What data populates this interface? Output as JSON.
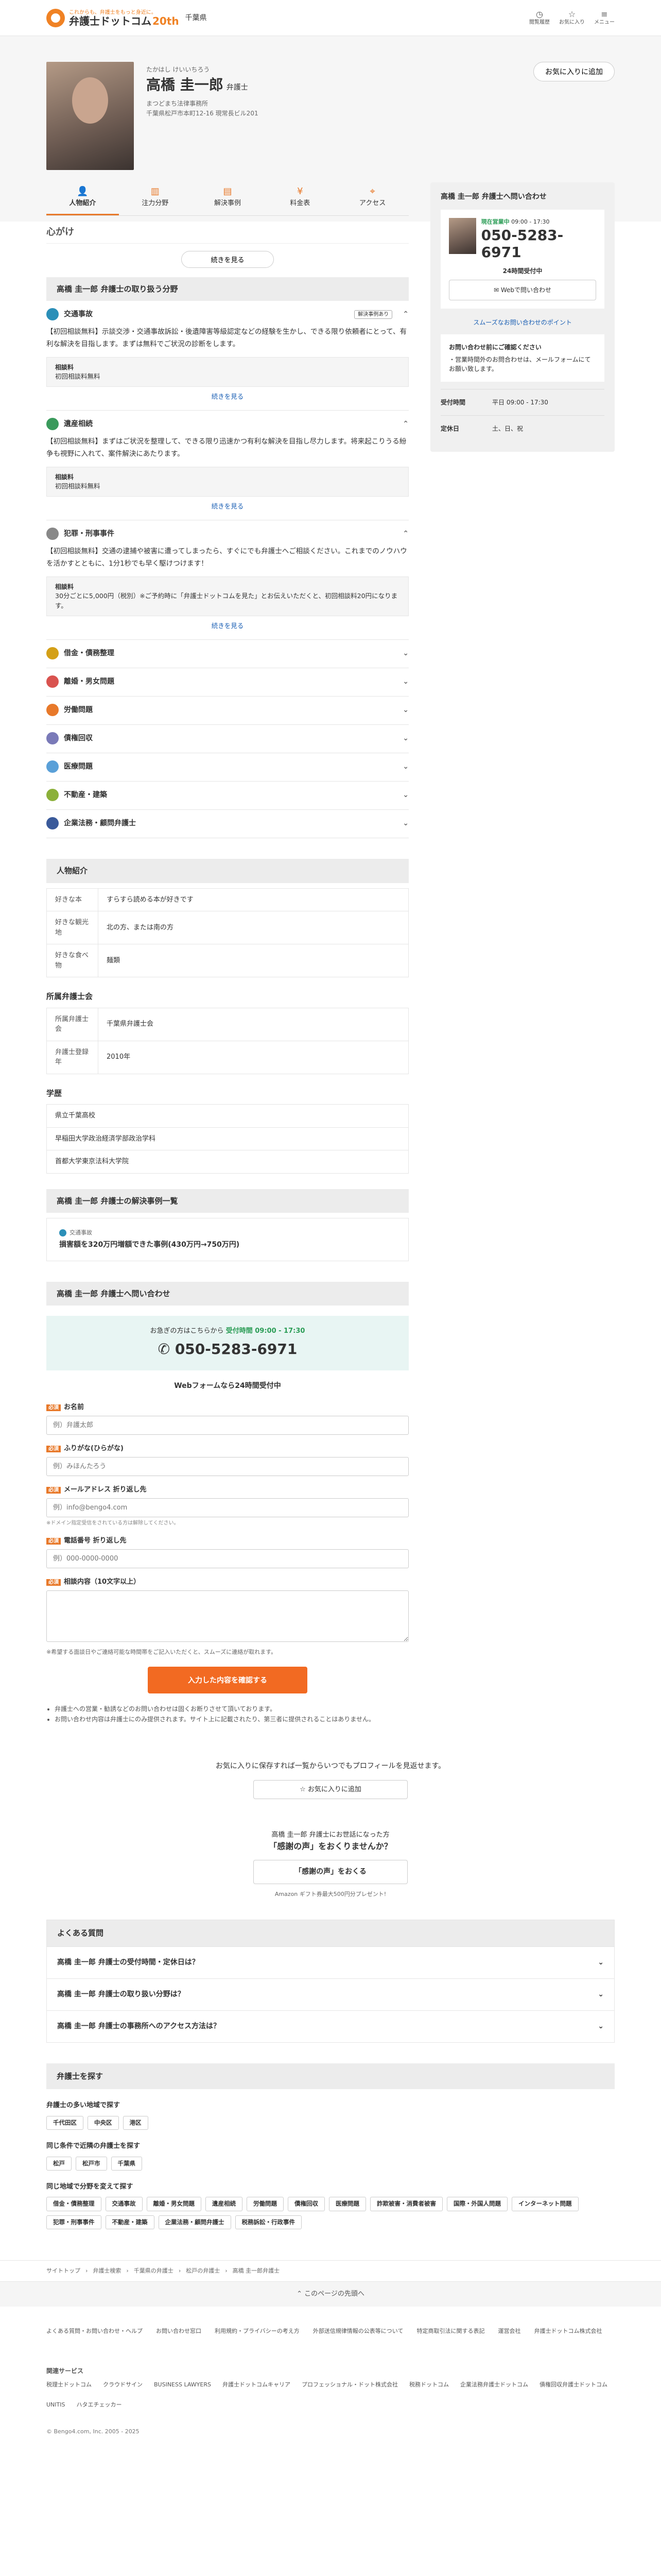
{
  "header": {
    "tagline": "これからも、弁護士をもっと身近に。",
    "brand": "弁護士ドットコム",
    "anniv": "20th",
    "pref": "千葉県",
    "icons": [
      {
        "icon": "clock-icon",
        "label": "閲覧履歴"
      },
      {
        "icon": "star-icon",
        "label": "お気に入り"
      },
      {
        "icon": "menu-icon",
        "label": "メニュー"
      }
    ]
  },
  "profile": {
    "kana": "たかはし けいいちろう",
    "name": "高橋 圭一郎",
    "title": "弁護士",
    "office": "まつどまち法律事務所",
    "address": "千葉県松戸市本町12-16 現常長ビル201",
    "fav_button": "お気に入りに追加"
  },
  "tabs": [
    {
      "icon": "person-icon",
      "label": "人物紹介"
    },
    {
      "icon": "bars-icon",
      "label": "注力分野"
    },
    {
      "icon": "document-icon",
      "label": "解決事例"
    },
    {
      "icon": "yen-icon",
      "label": "料金表"
    },
    {
      "icon": "pin-icon",
      "label": "アクセス"
    }
  ],
  "mindset": {
    "heading": "心がけ",
    "more": "続きを見る"
  },
  "fields": {
    "heading": "高橋 圭一郎 弁護士の取り扱う分野",
    "open": [
      {
        "name": "交通事故",
        "color": "#2b8fb8",
        "badge": "解決事例あり",
        "body": "【初回相談無料】示談交渉・交通事故訴訟・後遺障害等級認定などの経験を生かし、できる限り依頼者にとって、有利な解決を目指します。まずは無料でご状況の診断をします。",
        "fee_label": "相談料",
        "fee": "初回相談料無料",
        "more": "続きを見る"
      },
      {
        "name": "遺産相続",
        "color": "#3a9a5c",
        "badge": "",
        "body": "【初回相談無料】まずはご状況を整理して、できる限り迅速かつ有利な解決を目指し尽力します。将来起こりうる紛争も視野に入れて、案件解決にあたります。",
        "fee_label": "相談料",
        "fee": "初回相談料無料",
        "more": "続きを見る"
      },
      {
        "name": "犯罪・刑事事件",
        "color": "#888888",
        "badge": "",
        "body": "【初回相談無料】交通の逮捕や被害に遭ってしまったら、すぐにでも弁護士へご相談ください。これまでのノウハウを活かすとともに、1分1秒でも早く駆けつけます！",
        "fee_label": "相談料",
        "fee": "30分ごとに5,000円（税別）※ご予約時に「弁護士ドットコムを見た」とお伝えいただくと、初回相談料20円になります。",
        "more": "続きを見る"
      }
    ],
    "closed": [
      {
        "name": "借金・債務整理",
        "color": "#d4a017"
      },
      {
        "name": "離婚・男女問題",
        "color": "#d9534f"
      },
      {
        "name": "労働問題",
        "color": "#e8792a"
      },
      {
        "name": "債権回収",
        "color": "#7a7ab8"
      },
      {
        "name": "医療問題",
        "color": "#5aa0d8"
      },
      {
        "name": "不動産・建築",
        "color": "#8bb03a"
      },
      {
        "name": "企業法務・顧問弁護士",
        "color": "#3a5a9a"
      }
    ]
  },
  "person": {
    "heading": "人物紹介",
    "rows": [
      {
        "k": "好きな本",
        "v": "すらすら読める本が好きです"
      },
      {
        "k": "好きな観光地",
        "v": "北の方、または南の方"
      },
      {
        "k": "好きな食べ物",
        "v": "麺類"
      }
    ]
  },
  "assoc": {
    "heading": "所属弁護士会",
    "rows": [
      {
        "k": "所属弁護士会",
        "v": "千葉県弁護士会"
      },
      {
        "k": "弁護士登録年",
        "v": "2010年"
      }
    ]
  },
  "education": {
    "heading": "学歴",
    "items": [
      "県立千葉高校",
      "早稲田大学政治経済学部政治学科",
      "首都大学東京法科大学院"
    ]
  },
  "cases": {
    "heading": "高橋 圭一郎 弁護士の解決事例一覧",
    "field": "交通事故",
    "title": "損害額を320万円増額できた事例(430万円→750万円)"
  },
  "contact": {
    "heading": "高橋 圭一郎 弁護士へ問い合わせ",
    "prompt": "お急ぎの方はこちらから",
    "open_label": "受付時間 09:00 - 17:30",
    "tel": "050-5283-6971",
    "web24": "Webフォームなら24時間受付中",
    "fields": [
      {
        "label": "お名前",
        "placeholder": "例）弁護太郎",
        "hint": ""
      },
      {
        "label": "ふりがな(ひらがな)",
        "placeholder": "例）みほんたろう",
        "hint": ""
      },
      {
        "label": "メールアドレス 折り返し先",
        "placeholder": "例）info@bengo4.com",
        "hint": "※ドメイン指定受信をされている方は解除してください。"
      },
      {
        "label": "電話番号 折り返し先",
        "placeholder": "例）000-0000-0000",
        "hint": ""
      },
      {
        "label": "相談内容（10文字以上）",
        "placeholder": "",
        "hint": ""
      }
    ],
    "req": "必須",
    "note": "※希望する面談日やご連絡可能な時間帯をご記入いただくと、スムーズに連絡が取れます。",
    "submit": "入力した内容を確認する",
    "bullets": [
      "弁護士への営業・勧誘などのお問い合わせは固くお断りさせて頂いております。",
      "お問い合わせ内容は弁護士にのみ提供されます。サイト上に記載されたり、第三者に提供されることはありません。"
    ]
  },
  "side": {
    "heading": "高橋 圭一郎 弁護士へ問い合わせ",
    "open": "現在営業中",
    "hours": "09:00 - 17:30",
    "tel": "050-5283-6971",
    "web24": "24時間受付中",
    "web_btn": "Webで問い合わせ",
    "link": "スムーズなお問い合わせのポイント",
    "notice_h": "お問い合わせ前にご確認ください",
    "notice": "・営業時間外のお問合わせは、メールフォームにてお願い致します。",
    "kv": [
      {
        "k": "受付時間",
        "v": "平日 09:00 - 17:30"
      },
      {
        "k": "定休日",
        "v": "土、日、祝"
      }
    ]
  },
  "bottom": {
    "fav_line": "お気に入りに保存すれば一覧からいつでもプロフィールを見返せます。",
    "fav_btn": "お気に入りに追加",
    "thx_1": "高橋 圭一郎 弁護士にお世話になった方",
    "thx_2": "「感謝の声」をおくりませんか？",
    "thx_btn": "「感謝の声」をおくる",
    "thx_note": "Amazon ギフト券最大500円分プレゼント!"
  },
  "faq": {
    "heading": "よくある質問",
    "items": [
      "高橋 圭一郎 弁護士の受付時間・定休日は？",
      "高橋 圭一郎 弁護士の取り扱い分野は？",
      "高橋 圭一郎 弁護士の事務所へのアクセス方法は？"
    ]
  },
  "find": {
    "heading": "弁護士を探す",
    "g1": "弁護士の多い地域で探す",
    "t1": [
      "千代田区",
      "中央区",
      "港区"
    ],
    "g2": "同じ条件で近隣の弁護士を探す",
    "t2": [
      "松戸",
      "松戸市",
      "千葉県"
    ],
    "g3": "同じ地域で分野を変えて探す",
    "t3": [
      "借金・債務整理",
      "交通事故",
      "離婚・男女問題",
      "遺産相続",
      "労働問題",
      "債権回収",
      "医療問題",
      "詐欺被害・消費者被害",
      "国際・外国人問題",
      "インターネット問題",
      "犯罪・刑事事件",
      "不動産・建築",
      "企業法務・顧問弁護士",
      "税務訴訟・行政事件"
    ]
  },
  "crumb": [
    "サイトトップ",
    "弁護士検索",
    "千葉県の弁護士",
    "松戸の弁護士",
    "高橋 圭一郎弁護士"
  ],
  "to_top": "このページの先頭へ",
  "footer": {
    "links": [
      "よくある質問・お問い合わせ・ヘルプ",
      "お問い合わせ窓口",
      "利用規約・プライバシーの考え方",
      "外部送信規律情報の公表等について",
      "特定商取引法に関する表記",
      "運営会社",
      "弁護士ドットコム株式会社"
    ],
    "svc_h": "関連サービス",
    "svc": [
      "税理士ドットコム",
      "クラウドサイン",
      "BUSINESS LAWYERS",
      "弁護士ドットコムキャリア",
      "プロフェッショナル・ドット株式会社",
      "税務ドットコム",
      "企業法務弁護士ドットコム",
      "債権回収弁護士ドットコム",
      "UNITIS",
      "ハタエチェッカー"
    ],
    "copy": "© Bengo4.com, Inc. 2005 - 2025"
  }
}
